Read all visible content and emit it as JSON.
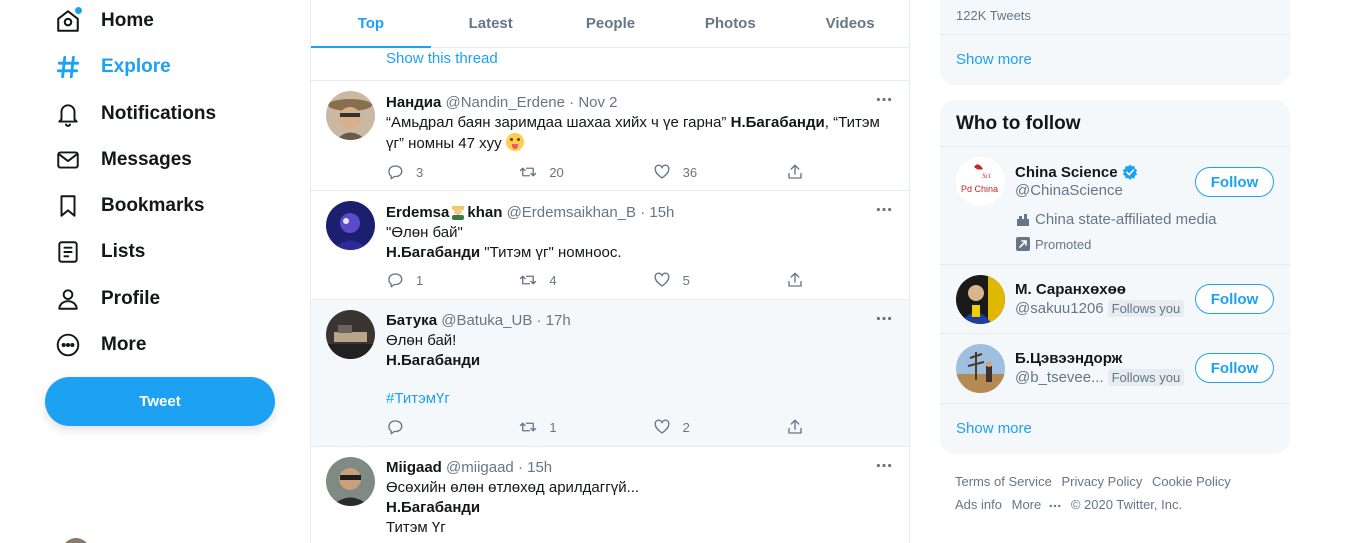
{
  "nav": {
    "home": "Home",
    "explore": "Explore",
    "notifications": "Notifications",
    "messages": "Messages",
    "bookmarks": "Bookmarks",
    "lists": "Lists",
    "profile": "Profile",
    "more": "More",
    "tweet_button": "Tweet"
  },
  "tabs": [
    "Top",
    "Latest",
    "People",
    "Photos",
    "Videos"
  ],
  "show_thread": "Show this thread",
  "tweets": [
    {
      "name": "Нандиа",
      "handle": "@Nandin_Erdene",
      "time": "Nov 2",
      "text_a": "“Амьдрал баян заримдаа шахаа хийх ч үе гарна” ",
      "text_b": "Н.Багабанди",
      "text_c": ", “Титэм үг” номны 47 хуу ",
      "replies": "3",
      "retweets": "20",
      "likes": "36"
    },
    {
      "name_a": "Erdemsa",
      "name_b": "khan",
      "handle": "@Erdemsaikhan_B",
      "time": "15h",
      "line1": "\"Өлөн бай\"",
      "line2_bold": "Н.Багабанди",
      "line2_rest": " \"Титэм үг\" номноос.",
      "replies": "1",
      "retweets": "4",
      "likes": "5"
    },
    {
      "name": "Батука",
      "handle": "@Batuka_UB",
      "time": "17h",
      "line1": "Өлөн бай!",
      "line2_bold": "Н.Багабанди",
      "hashtag": "#ТитэмҮг",
      "replies": "",
      "retweets": "1",
      "likes": "2"
    },
    {
      "name": "Miigaad",
      "handle": "@miigaad",
      "time": "15h",
      "line1": "Өсөхийн өлөн өтлөхөд арилдаггүй...",
      "line2_bold": "Н.Багабанди",
      "line3": "Титэм Үг"
    }
  ],
  "trends": {
    "count": "122K Tweets",
    "show_more": "Show more"
  },
  "who_to_follow": {
    "title": "Who to follow",
    "follow_label": "Follow",
    "follows_you": "Follows you",
    "users": [
      {
        "name": "China Science",
        "handle": "@ChinaScience",
        "affiliation": "China state-affiliated media",
        "promoted": "Promoted",
        "logo_top": "Sci",
        "logo_bottom": "Pd China"
      },
      {
        "name": "М. Саранхөхөө",
        "handle": "@sakuu1206"
      },
      {
        "name": "Б.Цэвээндорж",
        "handle": "@b_tsevee..."
      }
    ],
    "show_more": "Show more"
  },
  "footer": {
    "terms": "Terms of Service",
    "privacy": "Privacy Policy",
    "cookie": "Cookie Policy",
    "ads": "Ads info",
    "more": "More",
    "copyright": "© 2020 Twitter, Inc."
  },
  "colors": {
    "accent": "#1da1f2",
    "text": "#14171a",
    "secondary": "#657786",
    "panel": "#f5f8fa",
    "border": "#e6ecf0"
  }
}
